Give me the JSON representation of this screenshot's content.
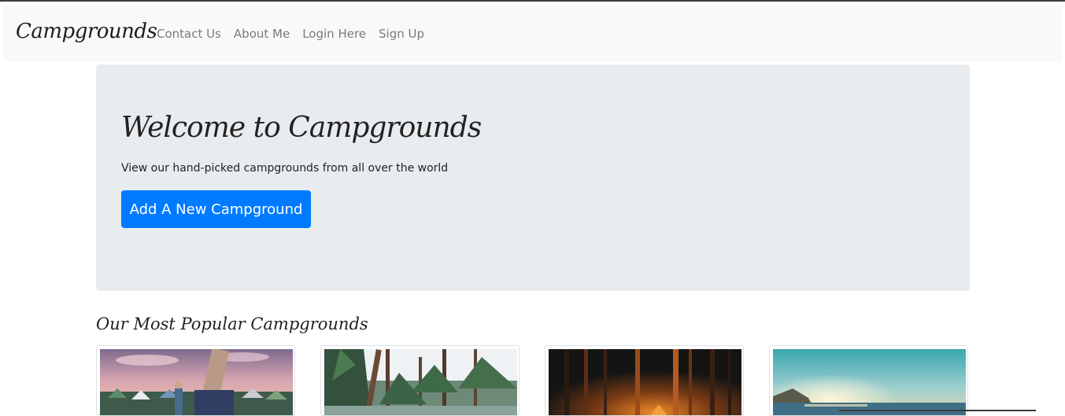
{
  "navbar": {
    "brand": "Campgrounds",
    "links": [
      {
        "label": "Contact Us"
      },
      {
        "label": "About Me"
      },
      {
        "label": "Login Here"
      },
      {
        "label": "Sign Up"
      }
    ]
  },
  "jumbotron": {
    "title": "Welcome to Campgrounds",
    "subtitle": "View our hand-picked campgrounds from all over the world",
    "button_label": "Add A New Campground"
  },
  "popular": {
    "heading": "Our Most Popular Campgrounds",
    "cards": [
      {
        "image": "festival-tents-sunset-image"
      },
      {
        "image": "pine-forest-lake-image"
      },
      {
        "image": "night-forest-campfire-image"
      },
      {
        "image": "ocean-sunrise-image"
      }
    ]
  },
  "colors": {
    "primary": "#007bff",
    "navbar_bg": "#f8f9fa",
    "jumbotron_bg": "#e9ecef",
    "nav_link": "#7a7a7a"
  }
}
